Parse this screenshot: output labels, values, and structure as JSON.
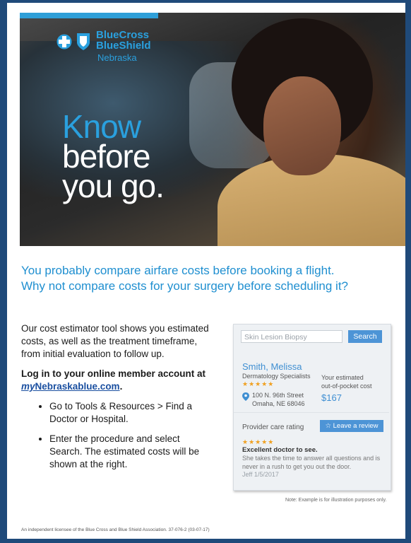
{
  "brand": {
    "name_line1": "BlueCross",
    "name_line2": "BlueShield",
    "region": "Nebraska"
  },
  "hero": {
    "headline": [
      "Know",
      "before",
      "you go."
    ]
  },
  "intro": {
    "line1": "You probably compare airfare costs before booking a flight.",
    "line2": "Why not compare costs for your surgery before scheduling it?"
  },
  "body": {
    "para": "Our cost estimator tool shows you estimated costs, as well as the treatment timeframe, from initial evaluation to follow up.",
    "login_prefix": "Log in to your online member account at ",
    "link_my": "my",
    "link_rest": "Nebraskablue.com",
    "login_suffix": ".",
    "steps": [
      "Go to Tools & Resources > Find a Doctor or Hospital.",
      "Enter the procedure and select Search. The estimated costs will be shown at the right."
    ]
  },
  "card": {
    "search_value": "Skin Lesion Biopsy",
    "search_button": "Search",
    "doctor_name": "Smith, Melissa",
    "specialty": "Dermatology Specialists",
    "stars": "★★★★★",
    "address_line1": "100 N. 96th Street",
    "address_line2": "Omaha, NE 68046",
    "estimate_label_1": "Your estimated",
    "estimate_label_2": "out-of-pocket cost",
    "cost": "$167",
    "rating_label": "Provider care rating",
    "review_button": "Leave a review",
    "review_stars": "★★★★★",
    "review_title": "Excellent doctor to see.",
    "review_text": "She takes the time to answer all questions and is never in a rush to get you out the door.",
    "review_date": "Jeff 1/5/2017"
  },
  "note": "Note: Example is for illustration purposes only.",
  "footer": "An independent licensee of the Blue Cross and Blue Shield Association.   37-076-2 (03-07-17)"
}
